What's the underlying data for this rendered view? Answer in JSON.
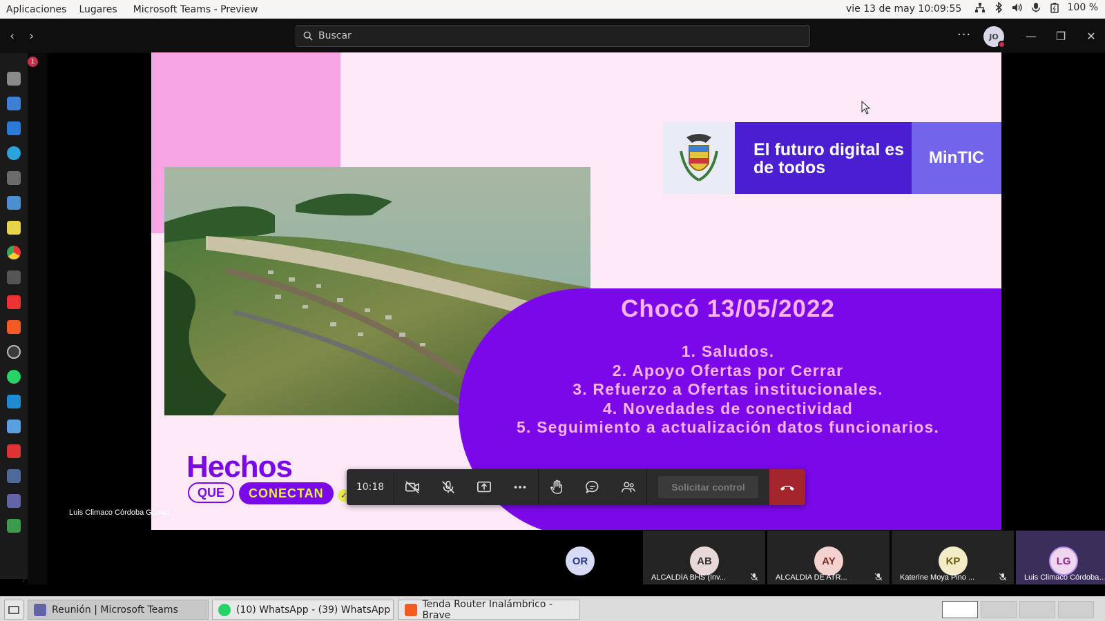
{
  "gnome": {
    "menu_apps": "Aplicaciones",
    "menu_places": "Lugares",
    "app_title": "Microsoft Teams - Preview",
    "clock": "vie 13 de may  10:09:55",
    "battery": "100 %"
  },
  "teams": {
    "search_placeholder": "Buscar",
    "user_initials": "JO",
    "activity_badge": "1"
  },
  "slide": {
    "tagline": "El futuro digital es de todos",
    "ministry": "MinTIC",
    "agenda_title": "Chocó 13/05/2022",
    "agenda": [
      "1. Saludos.",
      "2. Apoyo Ofertas por Cerrar",
      "3. Refuerzo a Ofertas institucionales.",
      "4. Novedades de conectividad",
      "5. Seguimiento a actualización datos funcionarios."
    ],
    "brand_word": "Hechos",
    "brand_que": "QUE",
    "brand_conectan": "CONECTAN"
  },
  "presenter": "Luis Climaco Córdoba Gómez",
  "controls": {
    "timer": "10:18",
    "request_control": "Solicitar control"
  },
  "participants": [
    {
      "initials": "OR",
      "name": "",
      "color": "#d7dbf3"
    },
    {
      "initials": "AB",
      "name": "ALCALDÍA BHS (Inv...",
      "color": "#e8d8d8"
    },
    {
      "initials": "AY",
      "name": "ALCALDIA DE ATR...",
      "color": "#f3d2cf"
    },
    {
      "initials": "KP",
      "name": "Katerine Moya Pino ...",
      "color": "#f4ecc6"
    },
    {
      "initials": "LG",
      "name": "Luis Climaco Córdoba Gó...",
      "color": "#f0d7f0"
    }
  ],
  "taskbar": {
    "teams": "Reunión | Microsoft Teams",
    "whatsapp": "(10) WhatsApp - (39) WhatsApp",
    "brave": "Tenda Router Inalámbrico - Brave"
  }
}
